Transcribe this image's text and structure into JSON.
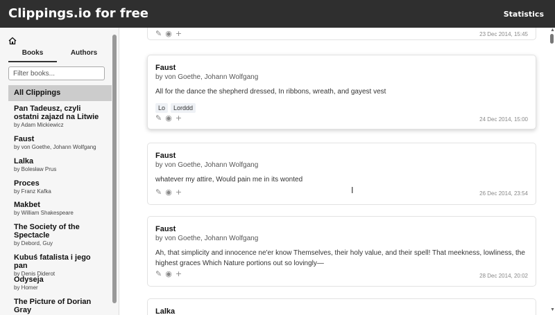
{
  "header": {
    "brand": "Clippings.io for free",
    "statistics_label": "Statistics"
  },
  "sidebar": {
    "tabs": [
      {
        "label": "Books"
      },
      {
        "label": "Authors"
      }
    ],
    "filter_placeholder": "Filter books...",
    "all_clippings_label": "All Clippings",
    "books": [
      {
        "title": "Pan Tadeusz, czyli ostatni zajazd na Litwie",
        "author": "by Adam Mickiewicz"
      },
      {
        "title": "Faust",
        "author": "by von Goethe, Johann Wolfgang"
      },
      {
        "title": "Lalka",
        "author": "by Bolesław Prus"
      },
      {
        "title": "Proces",
        "author": "by Franz Kafka"
      },
      {
        "title": "Makbet",
        "author": "by William Shakespeare"
      },
      {
        "title": "The Society of the Spectacle",
        "author": "by Debord, Guy"
      },
      {
        "title": "Kubuś fatalista i jego pan",
        "author": "by Denis Diderot"
      },
      {
        "title": "Odyseja",
        "author": "by Homer"
      },
      {
        "title": "The Picture of Dorian Gray",
        "author": ""
      }
    ]
  },
  "clippings": [
    {
      "date": "23 Dec 2014, 15:45"
    },
    {
      "title": "Faust",
      "author": "by von Goethe, Johann Wolfgang",
      "text": "All for the dance the shepherd dressed, In ribbons, wreath, and gayest vest",
      "tags": [
        "Lo",
        "Lorddd"
      ],
      "date": "24 Dec 2014, 15:00"
    },
    {
      "title": "Faust",
      "author": "by von Goethe, Johann Wolfgang",
      "text": "whatever my attire, Would pain me in its wonted",
      "date": "26 Dec 2014, 23:54"
    },
    {
      "title": "Faust",
      "author": "by von Goethe, Johann Wolfgang",
      "text": "Ah, that simplicity and innocence ne'er know Themselves, their holy value, and their spell! That meekness, lowliness, the highest graces Which Nature portions out so lovingly—",
      "date": "28 Dec 2014, 20:02"
    },
    {
      "title": "Lalka"
    }
  ],
  "icons": {
    "edit": "pencil-icon",
    "view": "eye-icon",
    "add": "plus-icon",
    "home": "home-icon"
  }
}
